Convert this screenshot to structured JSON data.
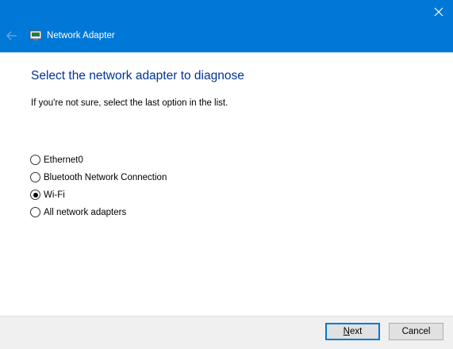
{
  "window": {
    "title": "Network Adapter"
  },
  "main": {
    "heading": "Select the network adapter to diagnose",
    "subtext": "If you're not sure, select the last option in the list.",
    "options": [
      {
        "label": "Ethernet0",
        "selected": false
      },
      {
        "label": "Bluetooth Network Connection",
        "selected": false
      },
      {
        "label": "Wi-Fi",
        "selected": true
      },
      {
        "label": "All network adapters",
        "selected": false
      }
    ]
  },
  "footer": {
    "next_label_accel": "N",
    "next_label_rest": "ext",
    "cancel_label": "Cancel"
  },
  "icons": {
    "close": "close-icon",
    "back": "back-arrow-icon",
    "app": "network-adapter-icon"
  },
  "colors": {
    "titlebar": "#0078d7",
    "heading": "#003399",
    "footer": "#f0f0f0"
  }
}
